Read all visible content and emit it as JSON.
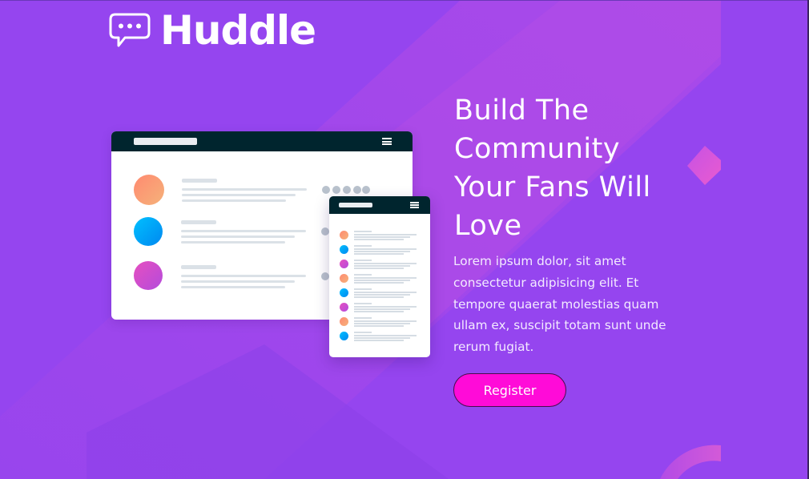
{
  "brand": {
    "name": "Huddle",
    "icon": "chat-bubble-icon"
  },
  "hero": {
    "title": "Build The Community Your Fans Will Love",
    "body": "Lorem ipsum dolor, sit amet consectetur adipisicing elit. Et tempore quaerat molestias quam ullam ex, suscipit totam sunt unde rerum fugiat.",
    "register_label": "Register"
  },
  "mockup": {
    "icons": [
      "menu-icon",
      "avatar-icon"
    ]
  },
  "colors": {
    "background": "#9545ef",
    "background_light": "#b04ce6",
    "button": "#ff0bd8",
    "mockup_bar": "#00252e",
    "text": "#ffffff"
  }
}
